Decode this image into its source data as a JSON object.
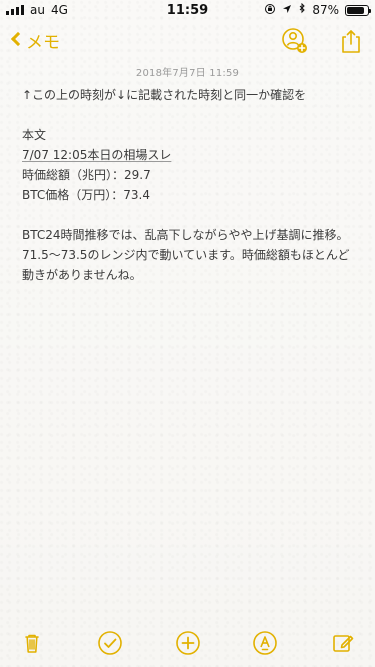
{
  "status_bar": {
    "carrier": "au",
    "network": "4G",
    "time": "11:59",
    "battery_percent": "87%",
    "battery_level": 0.87,
    "icons": [
      "signal-icon",
      "orientation-lock-icon",
      "location-icon",
      "bluetooth-icon",
      "battery-icon"
    ]
  },
  "nav": {
    "back_label": "メモ",
    "icons": {
      "collaborate": "add-people-icon",
      "share": "share-icon"
    }
  },
  "note": {
    "date": "2018年7月7日 11:59",
    "lines": [
      "↑この上の時刻が↓に記載された時刻と同一か確認を",
      "",
      "本文",
      "7/07 12:05本日の相場スレ",
      "時価総額（兆円）：29.7",
      "BTC価格（万円）：73.4",
      "",
      "BTC24時間推移では、乱高下しながらやや上げ基調に推移。71.5〜73.5のレンジ内で動いています。時価総額もほとんど動きがありませんね。"
    ]
  },
  "toolbar": {
    "icons": [
      "trash-icon",
      "checklist-icon",
      "add-icon",
      "markup-icon",
      "compose-icon"
    ]
  },
  "colors": {
    "accent": "#e2b100",
    "text": "#3a3a3a",
    "date": "#9a9a9a",
    "background": "#f7f6f3"
  }
}
